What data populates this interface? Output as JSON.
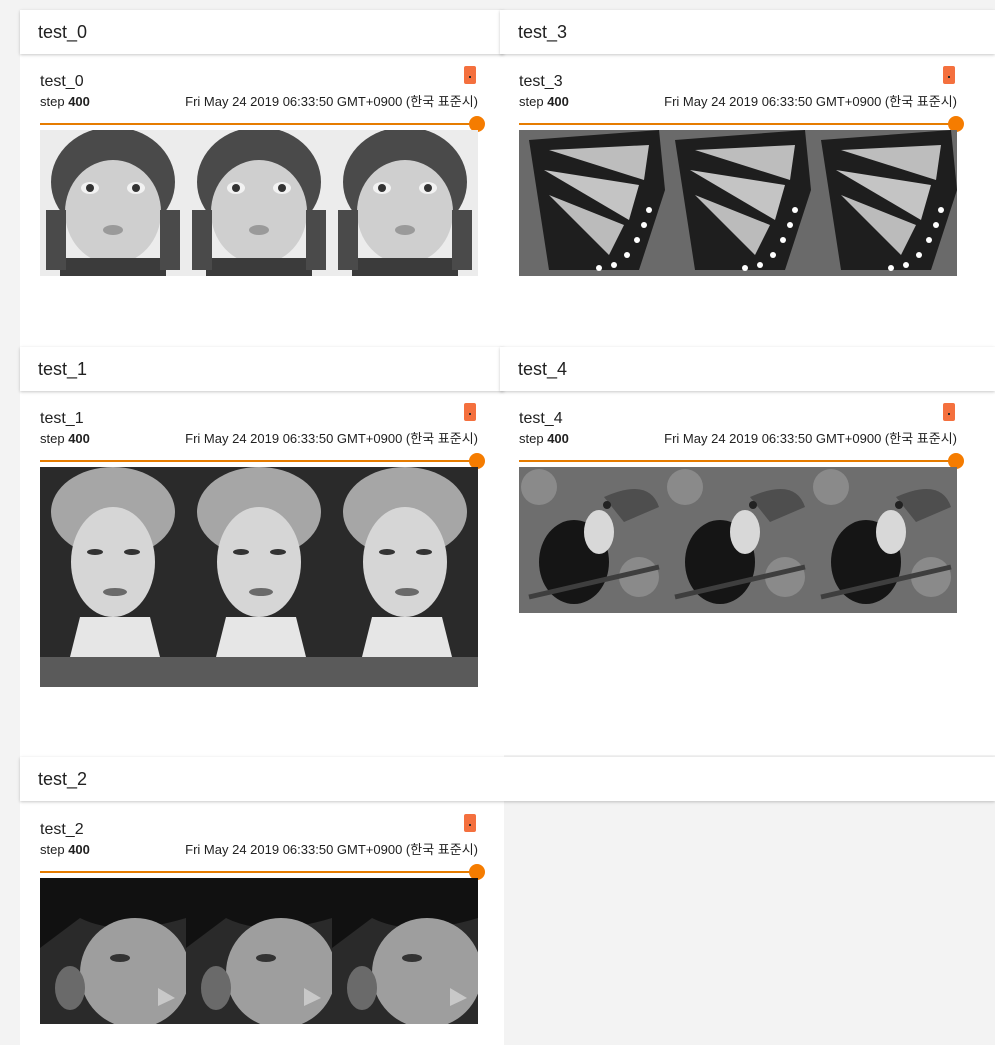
{
  "categories": [
    {
      "name": "test_0",
      "card": {
        "title": "test_0",
        "step_label": "step",
        "step": "400",
        "date": "Fri May 24 2019 06:33:50 GMT+0900 (한국 표준시)"
      }
    },
    {
      "name": "test_3",
      "card": {
        "title": "test_3",
        "step_label": "step",
        "step": "400",
        "date": "Fri May 24 2019 06:33:50 GMT+0900 (한국 표준시)"
      }
    },
    {
      "name": "test_1",
      "card": {
        "title": "test_1",
        "step_label": "step",
        "step": "400",
        "date": "Fri May 24 2019 06:33:50 GMT+0900 (한국 표준시)"
      }
    },
    {
      "name": "test_4",
      "card": {
        "title": "test_4",
        "step_label": "step",
        "step": "400",
        "date": "Fri May 24 2019 06:33:50 GMT+0900 (한국 표준시)"
      }
    },
    {
      "name": "test_2",
      "card": {
        "title": "test_2",
        "step_label": "step",
        "step": "400",
        "date": "Fri May 24 2019 06:33:50 GMT+0900 (한국 표준시)"
      }
    }
  ],
  "colors": {
    "accent": "#f57c00",
    "flag": "#f4703e"
  },
  "slider_position": 1.0
}
